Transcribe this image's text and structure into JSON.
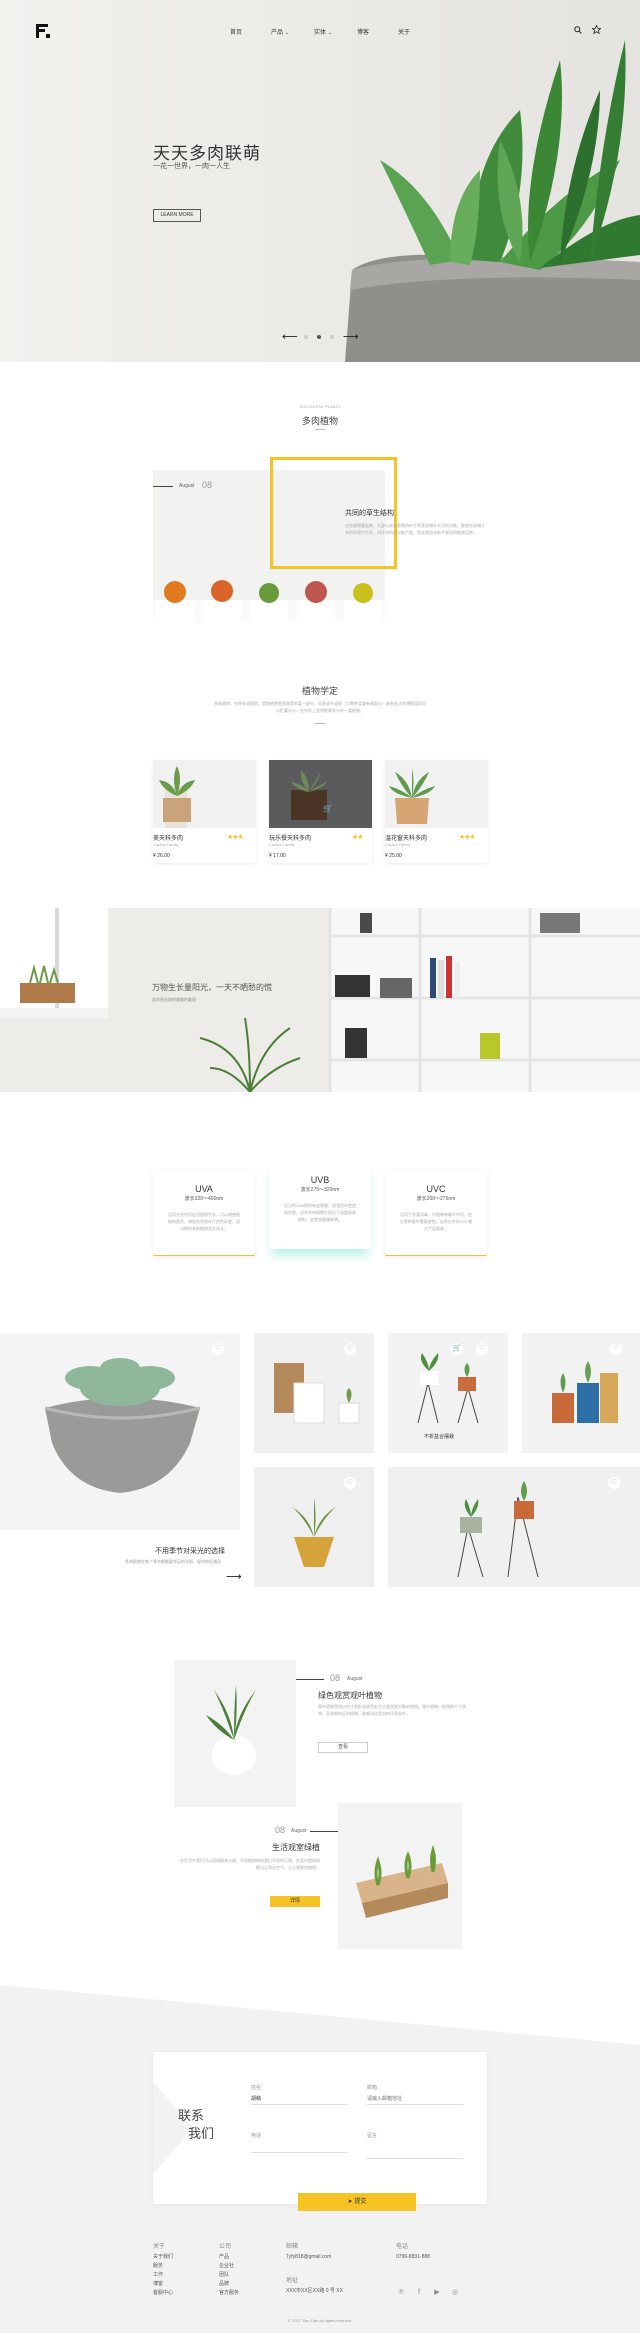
{
  "header": {
    "nav": [
      "首页",
      "产品",
      "实体",
      "博客",
      "关于"
    ],
    "nav_dropdown_icons": [
      "chevron-down-icon",
      "chevron-down-icon"
    ]
  },
  "hero": {
    "title": "天天多肉联萌",
    "subtitle": "一花一世界，一肉一人生",
    "button": "LEARN MORE",
    "slide_prev": "⟵",
    "slide_next": "⟶"
  },
  "section_succulents": {
    "small": "SUCCULENT PLANTS",
    "title": "多肉植物",
    "date_month": "August",
    "date_day": "08",
    "feature_title": "共同的草生结构",
    "feature_text": "这些植物看起来，大部分具有肥厚的叶片和茎部储存水分的功能。能够在极端干旱的环境中生存，对环境的适应能力强，是非常适合新手栽培的植物品种。"
  },
  "section_science": {
    "title": "植物学定",
    "text": "多肉植物，也称多浆植物，是指植物营养器官的某一部分，如茎或叶或根（少数种类兼有两部分）具有发达的薄壁组织用以贮藏水分，在外形上显得肥厚多汁的一类植物。"
  },
  "products": [
    {
      "name": "美天科多肉",
      "sub": "Cactus Family",
      "price": "¥ 26.00"
    },
    {
      "name": "玩乐餐天科多肉",
      "sub": "Cactus Family",
      "price": "¥ 17.00"
    },
    {
      "name": "温花窗天科多肉",
      "sub": "Cactus Family",
      "price": "¥ 25.00"
    }
  ],
  "banner": {
    "title": "万物生长量阳光，一天不晒愁的慌",
    "sub": "追求阳光照射就能的美丽"
  },
  "uv": [
    {
      "title": "UVA",
      "range": "波长320～400nm",
      "text": "适用光合作用促进植物生长，可以改善植物的颜色，增加花色和叶片的色彩度，适当照射有助植物茁壮成长。"
    },
    {
      "title": "UVB",
      "range": "波长275～320nm",
      "text": "适当的UVB照射有益植物，但强烈时会造成伤害。适合多肉植物在阳光下适度接收照射，会更加健康鲜艳。"
    },
    {
      "title": "UVC",
      "range": "波长200～275nm",
      "text": "适用于杀菌消毒，对植物有破坏作用，在日常种植中需要避免，自然光中的UVC被大气层吸收。"
    }
  ],
  "gallery": {
    "caption_title": "不用季节对采光的选择",
    "caption_sub": "多肉植物在各个季节都需要充足的光照，保持良好通风",
    "mid_label": "不折盆合摆栽",
    "arrow": "⟶"
  },
  "articles": [
    {
      "day": "08",
      "month": "August",
      "title": "绿色观赏观叶植物",
      "text": "观叶植物是指以叶片的形状或色彩为主要观赏对象的植物。观叶植物一般指原产于热带、亚热带地区的植物，能够适应室内的环境条件。",
      "button": "查看"
    },
    {
      "day": "08",
      "month": "August",
      "title": "生活观室绿植",
      "text": "在生活中我们可以用绿植来点缀，不同植物带给我们不同的心情，在室内摆放绿植可以净化空气，让心情更加愉悦。",
      "button": "详情"
    }
  ],
  "contact": {
    "title_1": "联系",
    "title_2": "我们",
    "name_label": "姓名",
    "name_value": "胡萌",
    "email_label": "邮箱",
    "email_placeholder": "请输入邮箱地址",
    "phone_label": "电话",
    "phone_placeholder": "",
    "message_label": "留言",
    "submit": "提交"
  },
  "footer": {
    "col1_title": "关于",
    "col1_items": [
      "关于我们",
      "服务",
      "工作",
      "博客",
      "客服中心"
    ],
    "col2_title": "公司",
    "col2_items": [
      "产品",
      "企业社",
      "团队",
      "品牌",
      "官方服务"
    ],
    "col3_title": "邮箱",
    "col3_value": "Tyfy818@gmail.com",
    "col3b_title": "地址",
    "col3b_value": "XXX市XX区XX路 0 号 XX",
    "col4_title": "电话",
    "col4_value": "0796-8831-888",
    "copyright": "© 2017 Tian Tian all rights reserved.",
    "social_icons": [
      "pinterest-icon",
      "facebook-icon",
      "youtube-icon",
      "dribbble-icon"
    ]
  },
  "colors": {
    "accent": "#f6c325",
    "teal_glow": "#b7efe6",
    "hero_bg": "#efeeeb"
  }
}
